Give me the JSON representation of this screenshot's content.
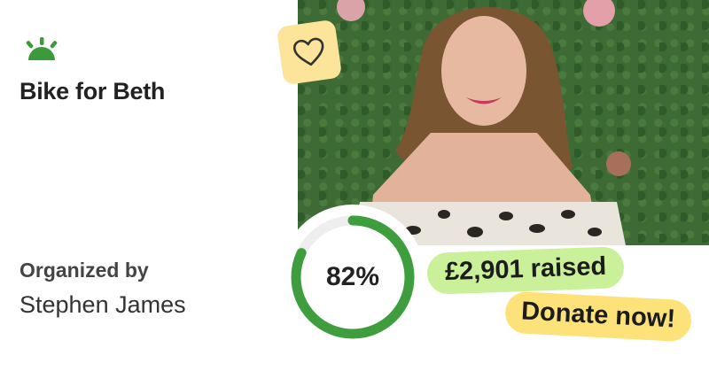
{
  "campaign": {
    "title": "Bike for Beth",
    "organizer_label": "Organized by",
    "organizer_name": "Stephen James"
  },
  "funding": {
    "progress_percent": 82,
    "progress_text": "82%",
    "raised_text": "£2,901 raised"
  },
  "actions": {
    "donate_label": "Donate now!"
  },
  "icons": {
    "brand": "sunrise-logo-icon",
    "favorite": "heart-icon"
  },
  "colors": {
    "brand_green": "#3b9b3b",
    "progress_green": "#3e9e3e",
    "progress_track": "#eeeeee",
    "raised_bg": "#caf19a",
    "donate_bg": "#fde27a",
    "heart_badge_bg": "#fce59a"
  }
}
